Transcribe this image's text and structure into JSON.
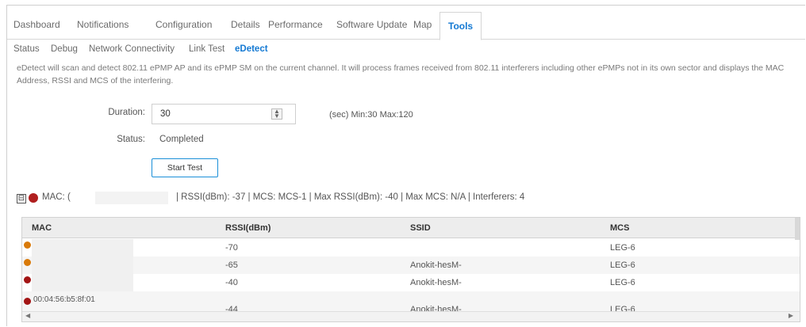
{
  "top_tabs": [
    {
      "label": "Dashboard"
    },
    {
      "label": "Notifications"
    },
    {
      "label": "Configuration"
    },
    {
      "label": "Details"
    },
    {
      "label": "Performance"
    },
    {
      "label": "Software Update"
    },
    {
      "label": "Map"
    },
    {
      "label": "Tools",
      "active": true
    }
  ],
  "sub_tabs": [
    {
      "label": "Status"
    },
    {
      "label": "Debug"
    },
    {
      "label": "Network Connectivity"
    },
    {
      "label": "Link Test"
    },
    {
      "label": "eDetect",
      "active": true
    }
  ],
  "description": "eDetect will scan and detect 802.11 ePMP AP and its ePMP SM on the current channel. It will process frames received from 802.11 interferers including other ePMPs not in its own sector and displays the MAC Address, RSSI and MCS of the interfering.",
  "form": {
    "duration_label": "Duration:",
    "duration_value": "30",
    "duration_range": "(sec) Min:30 Max:120",
    "status_label": "Status:",
    "status_value": "Completed",
    "start_button": "Start Test"
  },
  "summary": {
    "collapse_symbol": "⊟",
    "mac_label": "MAC: (",
    "details": "| RSSI(dBm): -37   |   MCS: MCS-1   |   Max RSSI(dBm): -40   |   Max MCS: N/A   |   Interferers: 4"
  },
  "table": {
    "headers": [
      "MAC",
      "RSSI(dBm)",
      "SSID",
      "MCS"
    ],
    "rows": [
      {
        "mac": "",
        "rssi": "-70",
        "ssid": "",
        "mcs": "LEG-6",
        "dot_color": "#d97a0a"
      },
      {
        "mac": "",
        "rssi": "-65",
        "ssid": "Anokit-hesM-",
        "mcs": "LEG-6",
        "dot_color": "#d97a0a"
      },
      {
        "mac": "",
        "rssi": "-40",
        "ssid": "Anokit-hesM-",
        "mcs": "LEG-6",
        "dot_color": "#a31515"
      },
      {
        "mac": "00:04:56:b5:8f:01",
        "rssi": "-44",
        "ssid": "Anokit-hesM-",
        "mcs": "LEG-6",
        "dot_color": "#a31515"
      }
    ]
  },
  "colors": {
    "accent": "#1479d3",
    "status_red": "#b01f1f",
    "status_orange": "#d97a0a"
  }
}
